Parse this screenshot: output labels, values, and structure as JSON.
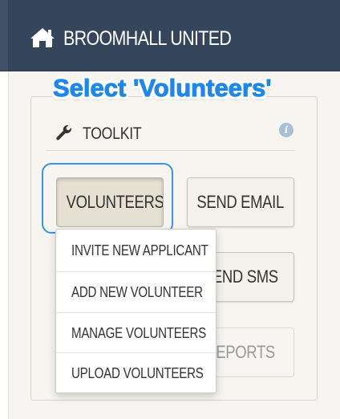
{
  "header": {
    "title": "BROOMHALL UNITED",
    "icon": "home-icon"
  },
  "annotation": {
    "text": "Select 'Volunteers'",
    "color": "#1f86ea"
  },
  "toolkit": {
    "title": "TOOLKIT",
    "title_icon": "wrench-icon",
    "info_icon": "info-icon",
    "buttons": {
      "volunteers": "VOLUNTEERS",
      "send_email": "SEND EMAIL",
      "send_sms": "SEND SMS",
      "reports": "REPORTS"
    },
    "dropdown": {
      "items": [
        "INVITE NEW APPLICANT",
        "ADD NEW VOLUNTEER",
        "MANAGE VOLUNTEERS",
        "UPLOAD VOLUNTEERS"
      ]
    }
  },
  "colors": {
    "header_bg": "#35455b",
    "highlight": "#3a93e8",
    "active_button": "#e4e0d2"
  }
}
